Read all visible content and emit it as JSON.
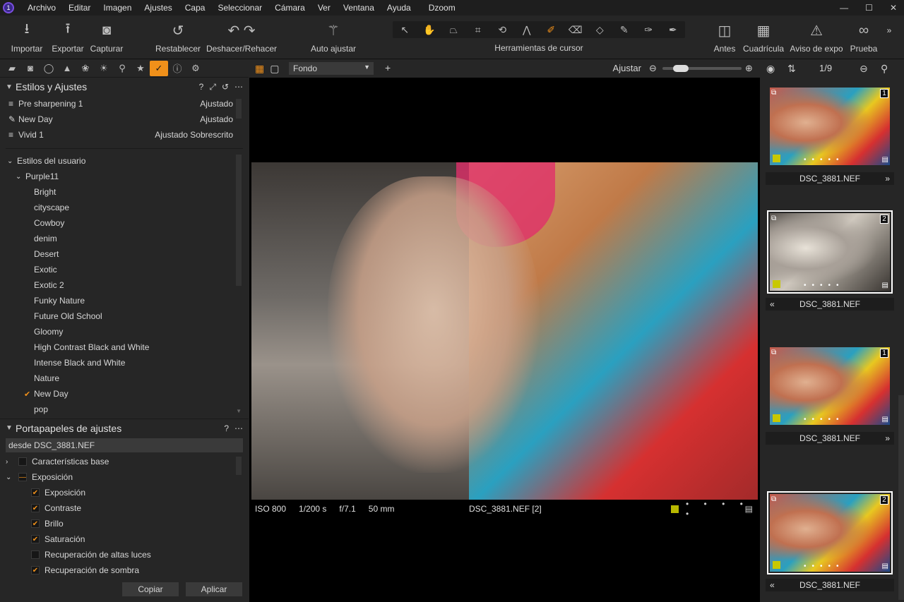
{
  "app": {
    "title": "Dzoom",
    "logo_text": "1"
  },
  "menu": [
    "Archivo",
    "Editar",
    "Imagen",
    "Ajustes",
    "Capa",
    "Seleccionar",
    "Cámara",
    "Ver",
    "Ventana",
    "Ayuda"
  ],
  "window_buttons": {
    "minimize": "—",
    "maximize": "☐",
    "close": "✕"
  },
  "toolbar": {
    "importar": "Importar",
    "exportar": "Exportar",
    "capturar": "Capturar",
    "restablecer": "Restablecer",
    "deshacer_rehacer": "Deshacer/Rehacer",
    "auto_ajustar": "Auto ajustar",
    "cursor_tools_label": "Herramientas de cursor",
    "antes": "Antes",
    "cuadricula": "Cuadrícula",
    "aviso_expo": "Aviso de expo",
    "prueba": "Prueba",
    "overflow": "»"
  },
  "styles_panel": {
    "title": "Estilos y Ajustes",
    "help": "?",
    "applied": [
      {
        "name": "Pre sharpening 1",
        "status": "Ajustado",
        "icon": "≡"
      },
      {
        "name": "New Day",
        "status": "Ajustado",
        "icon": "✎"
      },
      {
        "name": "Vivid 1",
        "status": "Ajustado Sobrescrito",
        "icon": "≡"
      }
    ],
    "user_styles_label": "Estilos del usuario",
    "group": "Purple11",
    "styles": [
      "Bright",
      "cityscape",
      "Cowboy",
      "denim",
      "Desert",
      "Exotic",
      "Exotic 2",
      "Funky Nature",
      "Future Old School",
      "Gloomy",
      "High Contrast Black and White",
      "Intense Black and White",
      "Nature",
      "New Day",
      "pop"
    ],
    "checked_style": "New Day"
  },
  "clipboard_panel": {
    "title": "Portapapeles de ajustes",
    "help": "?",
    "source": "desde  DSC_3881.NEF",
    "groups": [
      {
        "label": "Características base",
        "expanded": false,
        "state": "none"
      },
      {
        "label": "Exposición",
        "expanded": true,
        "state": "partial"
      }
    ],
    "items": [
      {
        "label": "Exposición",
        "checked": true
      },
      {
        "label": "Contraste",
        "checked": true
      },
      {
        "label": "Brillo",
        "checked": true
      },
      {
        "label": "Saturación",
        "checked": true
      },
      {
        "label": "Recuperación de altas luces",
        "checked": false
      },
      {
        "label": "Recuperación de sombra",
        "checked": true
      }
    ],
    "copy_label": "Copiar",
    "apply_label": "Aplicar"
  },
  "viewer": {
    "background_select": "Fondo",
    "fit_label": "Ajustar",
    "zoom_fraction": 0.15,
    "iso": "ISO 800",
    "shutter": "1/200 s",
    "aperture": "f/7.1",
    "focal": "50 mm",
    "filename": "DSC_3881.NEF [2]",
    "color_tag": "#b8b800",
    "rating_dots": "• • • • •"
  },
  "browser": {
    "counter": "1/9",
    "thumbnails": [
      {
        "name": "DSC_3881.NEF",
        "variant": "1",
        "style": "color",
        "selected": false,
        "nav": "»"
      },
      {
        "name": "DSC_3881.NEF",
        "variant": "2",
        "style": "bw",
        "selected": true,
        "nav": "«"
      },
      {
        "name": "DSC_3881.NEF",
        "variant": "1",
        "style": "color",
        "selected": false,
        "nav": "»"
      },
      {
        "name": "DSC_3881.NEF",
        "variant": "2",
        "style": "color",
        "selected": true,
        "nav": "«"
      }
    ]
  },
  "colors": {
    "accent": "#f0901a",
    "panel": "#262626",
    "dark": "#1d1d1d",
    "tag_yellow": "#c8c800"
  }
}
